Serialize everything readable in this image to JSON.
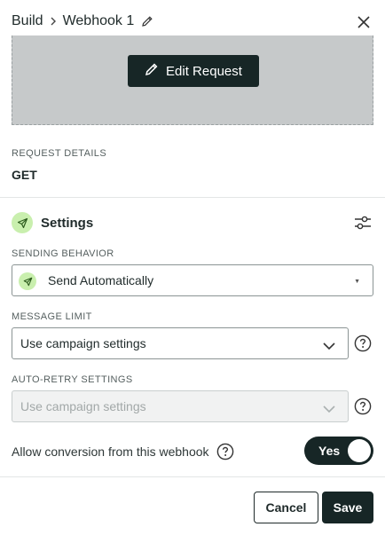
{
  "header": {
    "crumb_parent": "Build",
    "crumb_current": "Webhook 1",
    "icons": {
      "edit": "pencil-icon",
      "close": "close-icon",
      "separator": "chevron-right-icon"
    }
  },
  "preview": {
    "edit_button_label": "Edit Request",
    "edit_icon": "pencil-icon"
  },
  "request_details": {
    "label": "REQUEST DETAILS",
    "method": "GET"
  },
  "settings": {
    "title": "Settings",
    "icon": "paper-plane-icon",
    "options_icon": "sliders-icon",
    "sending_behavior": {
      "label": "SENDING BEHAVIOR",
      "value": "Send Automatically"
    },
    "message_limit": {
      "label": "MESSAGE LIMIT",
      "value": "Use campaign settings"
    },
    "auto_retry": {
      "label": "AUTO-RETRY SETTINGS",
      "value": "Use campaign settings",
      "disabled": true
    },
    "allow_conversion": {
      "label": "Allow conversion from this webhook",
      "toggle_label": "Yes",
      "enabled": true
    }
  },
  "footer": {
    "cancel_label": "Cancel",
    "save_label": "Save"
  },
  "colors": {
    "primary_dark": "#172626",
    "accent_green": "#c9efae",
    "preview_gray": "#c6c9ca"
  }
}
